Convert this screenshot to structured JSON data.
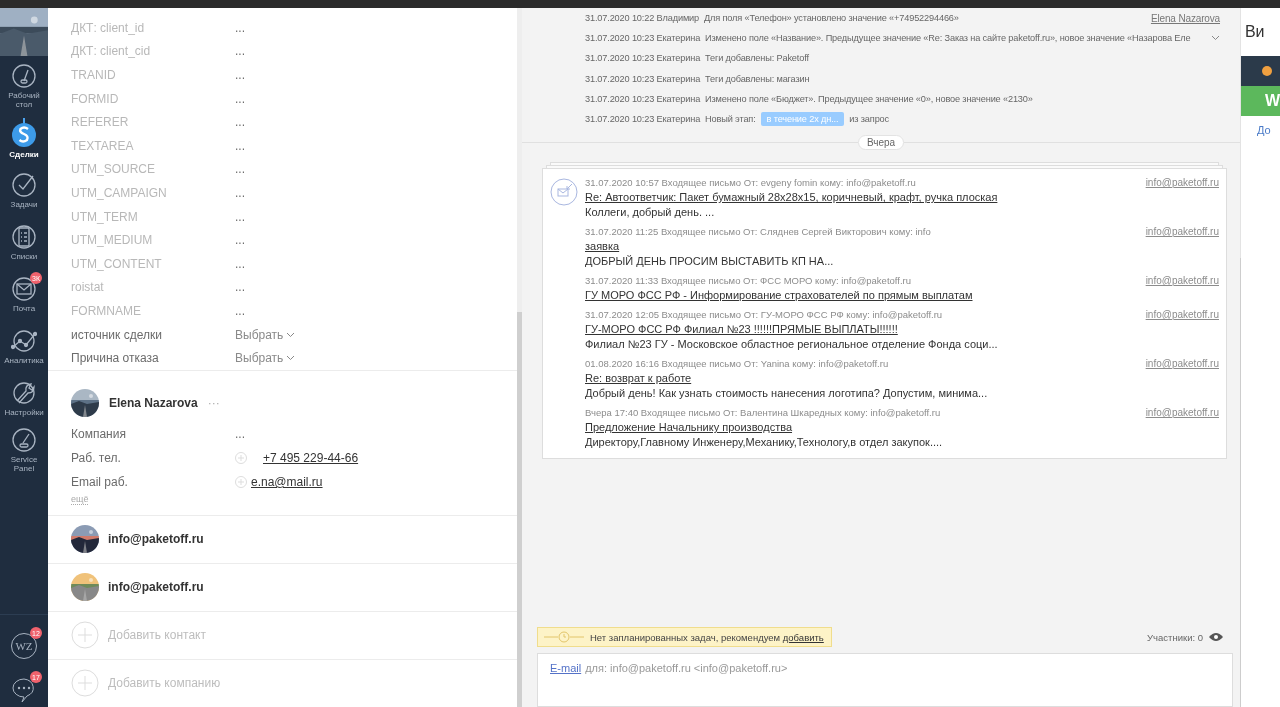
{
  "nav": {
    "items": [
      {
        "label": "Рабочий стол",
        "selected": false
      },
      {
        "label": "Сделки",
        "selected": true
      },
      {
        "label": "Задачи",
        "selected": false
      },
      {
        "label": "Списки",
        "selected": false
      },
      {
        "label": "Почта",
        "selected": false,
        "badge": "3К"
      },
      {
        "label": "Аналитика",
        "selected": false
      },
      {
        "label": "Настройки",
        "selected": false
      },
      {
        "label": "Service Panel",
        "selected": false
      }
    ],
    "bottom": [
      {
        "text": "WZ",
        "badge": "12"
      },
      {
        "badge": "17"
      }
    ]
  },
  "fields": [
    {
      "label": "ДКТ: client_id",
      "value": "...",
      "kind": "text",
      "dimmed": true
    },
    {
      "label": "ДКТ: client_cid",
      "value": "...",
      "kind": "text",
      "dimmed": true
    },
    {
      "label": "TRANID",
      "value": "...",
      "kind": "text",
      "dimmed": true
    },
    {
      "label": "FORMID",
      "value": "...",
      "kind": "text",
      "dimmed": true
    },
    {
      "label": "REFERER",
      "value": "...",
      "kind": "text",
      "dimmed": true
    },
    {
      "label": "TEXTAREA",
      "value": "...",
      "kind": "text",
      "dimmed": true
    },
    {
      "label": "UTM_SOURCE",
      "value": "...",
      "kind": "text",
      "dimmed": true
    },
    {
      "label": "UTM_CAMPAIGN",
      "value": "...",
      "kind": "text",
      "dimmed": true
    },
    {
      "label": "UTM_TERM",
      "value": "...",
      "kind": "text",
      "dimmed": true
    },
    {
      "label": "UTM_MEDIUM",
      "value": "...",
      "kind": "text",
      "dimmed": true
    },
    {
      "label": "UTM_CONTENT",
      "value": "...",
      "kind": "text",
      "dimmed": true
    },
    {
      "label": "roistat",
      "value": "...",
      "kind": "text",
      "dimmed": true
    },
    {
      "label": "FORMNAME",
      "value": "...",
      "kind": "text",
      "dimmed": true
    },
    {
      "label": "источник сделки",
      "placeholder": "Выбрать",
      "kind": "select",
      "dimmed": false
    },
    {
      "label": "Причина отказа",
      "placeholder": "Выбрать",
      "kind": "select",
      "dimmed": false
    }
  ],
  "contact": {
    "name": "Elena Nazarova",
    "more": "···",
    "fields": [
      {
        "label": "Компания",
        "value": "...",
        "kind": "text"
      },
      {
        "label": "Раб. тел.",
        "value": "+7 495 229-44-66",
        "kind": "phone"
      },
      {
        "label": "Email раб.",
        "value": "e.na@mail.ru",
        "kind": "email"
      }
    ],
    "more_link": "ещё"
  },
  "linked": [
    {
      "name": "info@paketoff.ru",
      "kind": "picture"
    },
    {
      "name": "info@paketoff.ru",
      "kind": "picture"
    }
  ],
  "add_actions": [
    "Добавить контакт",
    "Добавить компанию"
  ],
  "history": [
    {
      "date": "31.07.2020 10:22",
      "author": "Владимир",
      "text": "Для поля «Телефон» установлено значение «+74952294466»",
      "kind": "link",
      "link": "Elena Nazarova"
    },
    {
      "date": "31.07.2020 10:23",
      "author": "Екатерина",
      "text": "Изменено поле «Название». Предыдущее значение «Re: Заказ на сайте paketoff.ru», новое значение «Назарова Еле",
      "kind": "expand"
    },
    {
      "date": "31.07.2020 10:23",
      "author": "Екатерина",
      "text": "Теги добавлены: Paketoff",
      "kind": "plain"
    },
    {
      "date": "31.07.2020 10:23",
      "author": "Екатерина",
      "text": "Теги добавлены: магазин",
      "kind": "plain"
    },
    {
      "date": "31.07.2020 10:23",
      "author": "Екатерина",
      "text": "Изменено поле «Бюджет». Предыдущее значение «0», новое значение «2130»",
      "kind": "plain"
    },
    {
      "date": "31.07.2020 10:23",
      "author": "Екатерина",
      "text": "Новый этап:",
      "kind": "stage",
      "stage": "в течение 2х дн...",
      "after": "из запрос"
    }
  ],
  "separator": "Вчера",
  "emails": [
    {
      "meta": "31.07.2020 10:57 Входящее письмо От: evgeny fomin кому: info@paketoff.ru",
      "subject": "Re: Автоответчик: Пакет бумажный 28x28x15, коричневый, крафт, ручка плоская",
      "preview": "Коллеги, добрый день. ...",
      "to": "info@paketoff.ru"
    },
    {
      "meta": "31.07.2020 11:25 Входящее письмо От: Сляднев Сергей Викторович кому: info",
      "subject": "заявка",
      "preview": "ДОБРЫЙ ДЕНЬ ПРОСИМ ВЫСТАВИТЬ КП НА...",
      "to": "info@paketoff.ru"
    },
    {
      "meta": "31.07.2020 11:33 Входящее письмо От: ФСС МОРО кому: info@paketoff.ru",
      "subject": "ГУ МОРО ФСС РФ - Информирование страхователей по прямым выплатам",
      "to": "info@paketoff.ru"
    },
    {
      "meta": "31.07.2020 12:05 Входящее письмо От: ГУ-МОРО ФСС РФ кому: info@paketoff.ru",
      "subject": "ГУ-МОРО ФСС РФ Филиал №23 !!!!!!ПРЯМЫЕ ВЫПЛАТЫ!!!!!!",
      "preview": "Филиал №23 ГУ - Московское областное региональное отделение Фонда соци...",
      "to": "info@paketoff.ru"
    },
    {
      "meta": "01.08.2020 16:16 Входящее письмо От: Yanina кому: info@paketoff.ru",
      "subject": "Re: возврат к работе",
      "preview": "Добрый день! Как узнать стоимость нанесения логотипа? Допустим, минима...",
      "to": "info@paketoff.ru"
    },
    {
      "meta": "Вчера 17:40 Входящее письмо От: Валентина Шкаредных кому: info@paketoff.ru",
      "subject": "Предложение Начальнику производства",
      "preview": "Директору,Главному Инженеру,Механику,Технологу,в отдел закупок....",
      "to": "info@paketoff.ru"
    }
  ],
  "task_notice": {
    "text": "Нет запланированных задач, рекомендуем ",
    "link": "добавить"
  },
  "participants": "Участники: 0",
  "composer": {
    "type": "E-mail",
    "to_label": "для:",
    "to": "info@paketoff.ru <info@paketoff.ru>"
  },
  "right_panel": {
    "title": "Ви",
    "button": "W",
    "link": "До"
  }
}
